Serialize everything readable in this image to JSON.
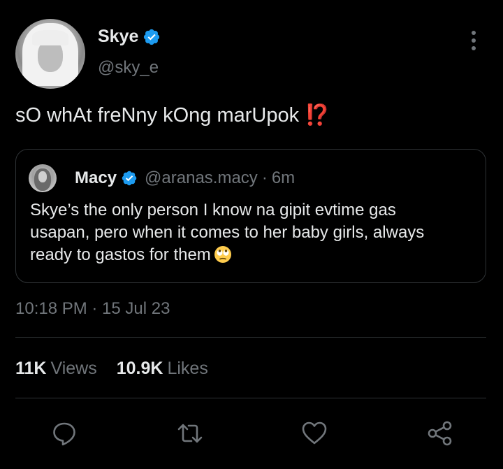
{
  "author": {
    "display_name": "Skye",
    "handle": "@sky_e",
    "verified": true,
    "avatar_icon": "avatar-photo"
  },
  "tweet": {
    "text": "sO whAt freNny kOng marUpok ",
    "emoji": "⁉️",
    "timestamp": "10:18 PM · 15 Jul 23"
  },
  "quoted_tweet": {
    "display_name": "Macy",
    "handle": "@aranas.macy",
    "separator": "·",
    "time": "6m",
    "lines": [
      "Skye’s the only person I know na gipit evtime gas",
      "usapan, pero when it comes to her baby girls, always",
      "ready to gastos for them"
    ],
    "emoji_icon": "face-with-rolling-eyes-icon"
  },
  "stats": {
    "views_value": "11K",
    "views_label": "Views",
    "likes_value": "10.9K",
    "likes_label": "Likes"
  },
  "actions": [
    "reply-icon",
    "retweet-icon",
    "like-icon",
    "share-icon"
  ],
  "colors": {
    "background": "#000000",
    "text_primary": "#e7e9ea",
    "text_secondary": "#71767b",
    "border": "#2f3336",
    "verified_blue": "#1d9bf0",
    "emoji_red": "#f4212e"
  }
}
